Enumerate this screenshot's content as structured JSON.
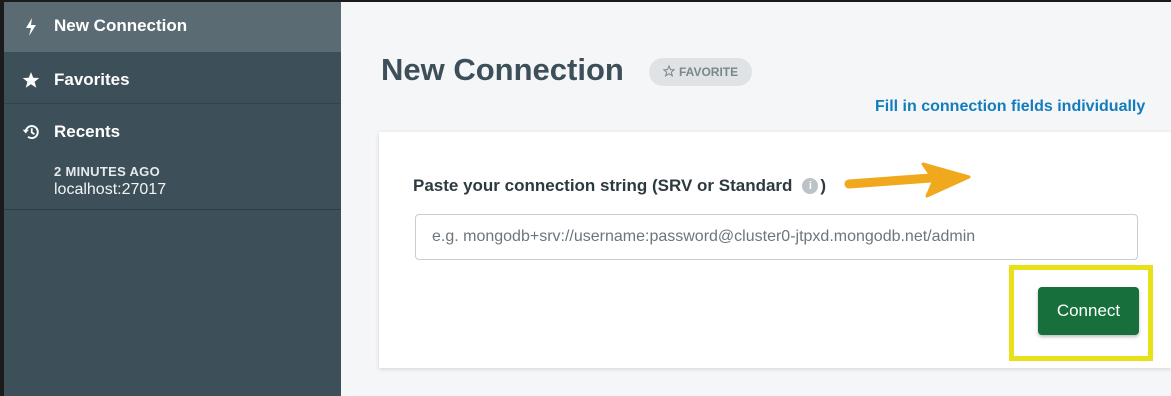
{
  "sidebar": {
    "new_connection": "New Connection",
    "favorites": "Favorites",
    "recents": "Recents",
    "recent_items": [
      {
        "time": "2 MINUTES AGO",
        "host": "localhost:27017"
      }
    ],
    "icons": {
      "new_connection": "lightning-icon",
      "favorites": "star-icon",
      "recents": "history-icon"
    }
  },
  "main": {
    "title": "New Connection",
    "favorite_badge": "FAVORITE",
    "fill_link": "Fill in connection fields individually",
    "connection_label": "Paste your connection string (SRV or Standard",
    "connection_label_close": ")",
    "input_placeholder": "e.g. mongodb+srv://username:password@cluster0-jtpxd.mongodb.net/admin",
    "input_value": "",
    "connect_label": "Connect",
    "info_glyph": "i"
  },
  "colors": {
    "sidebar_bg": "#3d4f58",
    "sidebar_active": "#5b6b73",
    "link": "#137cbd",
    "connect_button": "#176f3c",
    "highlight": "#e8e018",
    "arrow": "#f0a81c"
  }
}
